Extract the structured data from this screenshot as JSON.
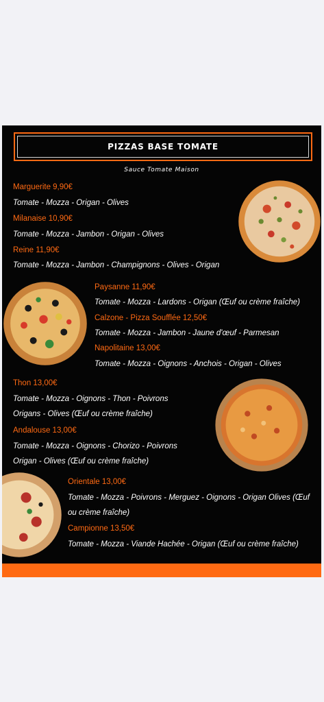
{
  "menu": {
    "title": "PIZZAS BASE TOMATE",
    "subtitle": "Sauce Tomate Maison",
    "items": [
      {
        "name": "Marguerite 9,90€",
        "desc": [
          "Tomate -  Mozza - Origan - Olives"
        ]
      },
      {
        "name": "Milanaise 10,90€",
        "desc": [
          "Tomate -  Mozza - Jambon - Origan -  Olives"
        ]
      },
      {
        "name": "Reine 11,90€",
        "desc": [
          "Tomate - Mozza - Jambon -  Champignons - Olives - Origan"
        ]
      },
      {
        "name": "Paysanne 11,90€",
        "desc": [
          "Tomate -  Mozza - Lardons - Origan (Œuf ou crème fraîche)"
        ]
      },
      {
        "name": "Calzone - Pizza Soufflée 12,50€",
        "desc": [
          "Tomate -  Mozza - Jambon - Jaune d'œuf - Parmesan"
        ]
      },
      {
        "name": "Napolitaine 13,00€",
        "desc": [
          "Tomate - Mozza - Oignons - Anchois - Origan - Olives"
        ]
      },
      {
        "name": "Thon 13,00€",
        "desc": [
          "Tomate -  Mozza - Oignons - Thon - Poivrons",
          "Origans - Olives (Œuf ou crème fraîche)"
        ]
      },
      {
        "name": "Andalouse 13,00€",
        "desc": [
          "Tomate -  Mozza - Oignons - Chorizo - Poivrons",
          "Origan - Olives (Œuf ou crème fraîche)"
        ]
      },
      {
        "name": "Orientale 13,00€",
        "desc": [
          "Tomate - Mozza - Poivrons - Merguez - Oignons - Origan  Olives (Œuf",
          "ou crème fraîche)"
        ]
      },
      {
        "name": "Campionne 13,50€",
        "desc": [
          "Tomate -  Mozza - Viande Hachée -  Origan  (Œuf ou crème fraîche)"
        ]
      }
    ]
  },
  "colors": {
    "accent": "#ff6a13",
    "background": "#050505",
    "text": "#ffffff",
    "page": "#f2f2f6"
  }
}
